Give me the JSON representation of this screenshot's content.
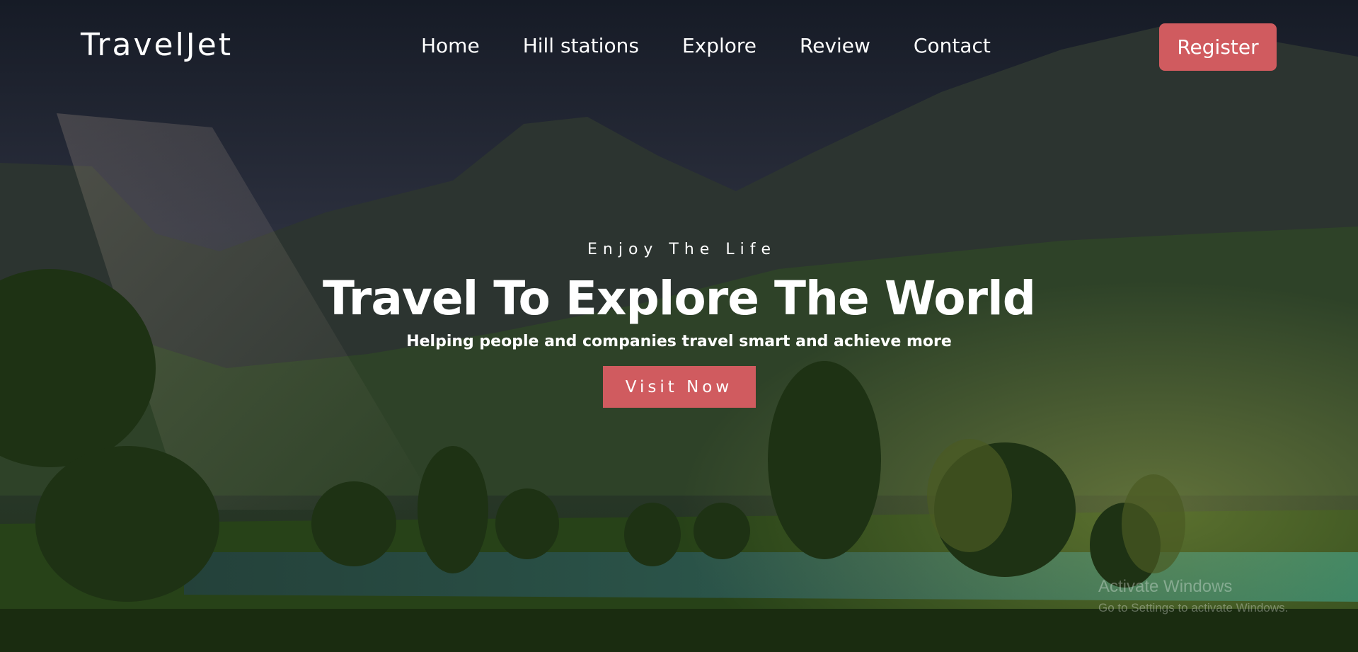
{
  "header": {
    "logo": "TravelJet",
    "nav": [
      "Home",
      "Hill stations",
      "Explore",
      "Review",
      "Contact"
    ],
    "register_label": "Register"
  },
  "hero": {
    "kicker": "Enjoy The Life",
    "title": "Travel To Explore The World",
    "subtitle": "Helping people and companies travel smart and achieve more",
    "cta_label": "Visit Now"
  },
  "watermark": {
    "title": "Activate Windows",
    "subtitle": "Go to Settings to activate Windows."
  },
  "colors": {
    "accent": "#d05b5f",
    "text": "#ffffff",
    "overlay": "#1a2030"
  }
}
